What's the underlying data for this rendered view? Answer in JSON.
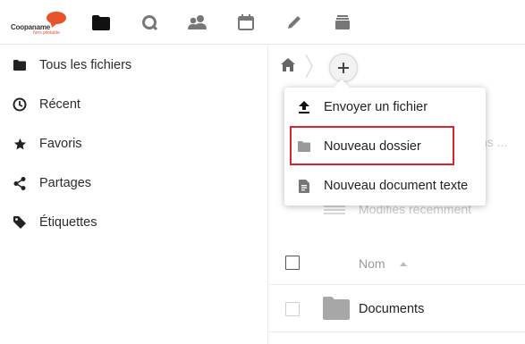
{
  "header": {
    "logo_name": "Coopaname",
    "logo_tagline": "hors pilotable",
    "apps": [
      {
        "name": "files",
        "icon": "folder-icon"
      },
      {
        "name": "activity",
        "icon": "activity-icon"
      },
      {
        "name": "contacts",
        "icon": "contacts-icon"
      },
      {
        "name": "calendar",
        "icon": "calendar-icon"
      },
      {
        "name": "notes",
        "icon": "pencil-icon"
      },
      {
        "name": "deck",
        "icon": "stack-icon"
      }
    ]
  },
  "sidebar": {
    "items": [
      {
        "label": "Tous les fichiers",
        "icon": "folder-icon"
      },
      {
        "label": "Récent",
        "icon": "clock-icon"
      },
      {
        "label": "Favoris",
        "icon": "star-icon"
      },
      {
        "label": "Partages",
        "icon": "share-icon"
      },
      {
        "label": "Étiquettes",
        "icon": "tag-icon"
      }
    ]
  },
  "breadcrumb": {
    "home_icon": "home-icon",
    "add_icon": "plus-icon"
  },
  "background": {
    "partial_text": "ns ...",
    "recent_text": "Modifiés récemment"
  },
  "list": {
    "header_name": "Nom",
    "rows": [
      {
        "name": "Documents",
        "type": "folder"
      }
    ]
  },
  "menu": {
    "items": [
      {
        "label": "Envoyer un fichier",
        "icon": "upload-icon"
      },
      {
        "label": "Nouveau dossier",
        "icon": "folder-icon",
        "highlighted": true
      },
      {
        "label": "Nouveau document texte",
        "icon": "text-document-icon"
      }
    ]
  },
  "colors": {
    "accent": "#e8532c",
    "highlight_border": "#d9242c",
    "folder": "#a7a7a7"
  }
}
